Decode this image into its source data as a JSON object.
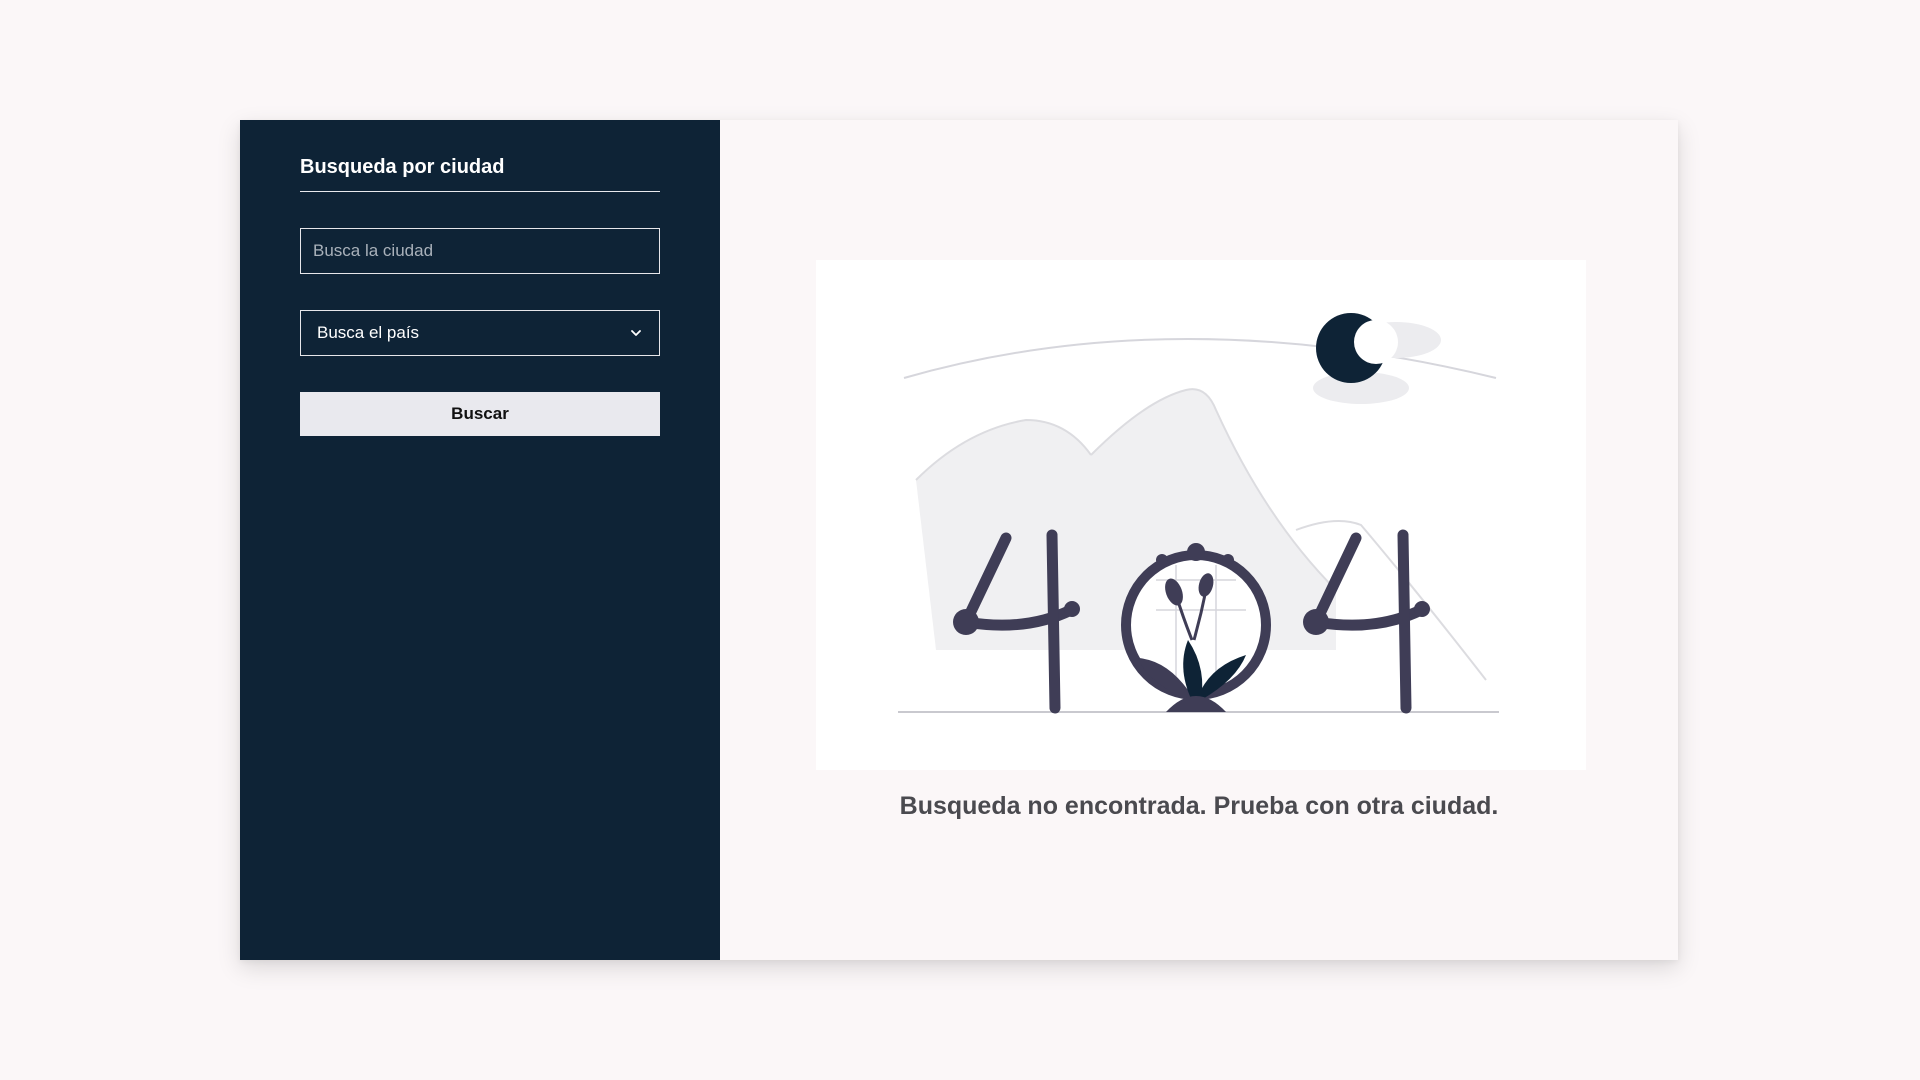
{
  "sidebar": {
    "title": "Busqueda por ciudad",
    "city_input": {
      "value": "",
      "placeholder": "Busca la ciudad"
    },
    "country_select": {
      "selected": "Busca el país"
    },
    "search_button_label": "Buscar"
  },
  "main": {
    "illustration": {
      "text": "404"
    },
    "message": "Busqueda no encontrada. Prueba con otra ciudad."
  },
  "colors": {
    "sidebar_bg": "#0e2336",
    "page_bg": "#fbf7f8",
    "button_bg": "#e9e9ee",
    "illustration_dark": "#3f3d56",
    "illustration_accent": "#0e2336"
  },
  "icons": {
    "select_arrow": "chevron-down-icon"
  }
}
